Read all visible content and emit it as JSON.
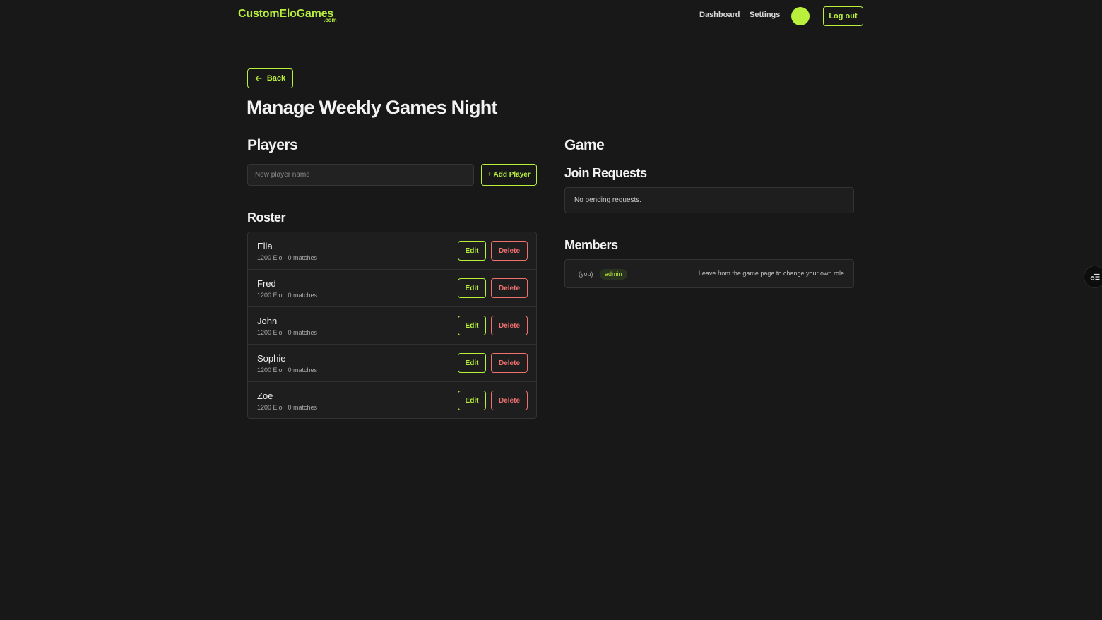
{
  "header": {
    "logo": "CustomEloGames",
    "logo_suffix": ".com",
    "nav": {
      "dashboard": "Dashboard",
      "settings": "Settings",
      "logout": "Log out"
    }
  },
  "page": {
    "back_label": "Back",
    "title": "Manage Weekly Games Night"
  },
  "players": {
    "heading": "Players",
    "input_placeholder": "New player name",
    "add_label": "+ Add Player",
    "roster_heading": "Roster",
    "edit_label": "Edit",
    "delete_label": "Delete",
    "items": [
      {
        "name": "Ella",
        "stats": "1200 Elo · 0 matches"
      },
      {
        "name": "Fred",
        "stats": "1200 Elo · 0 matches"
      },
      {
        "name": "John",
        "stats": "1200 Elo · 0 matches"
      },
      {
        "name": "Sophie",
        "stats": "1200 Elo · 0 matches"
      },
      {
        "name": "Zoe",
        "stats": "1200 Elo · 0 matches"
      }
    ]
  },
  "game": {
    "heading": "Game",
    "join_heading": "Join Requests",
    "join_empty": "No pending requests.",
    "members_heading": "Members",
    "member": {
      "you": "(you)",
      "role": "admin",
      "note": "Leave from the game page to change your own role"
    }
  },
  "colors": {
    "accent": "#b8f03c",
    "danger": "#f07070",
    "background": "#181818"
  }
}
